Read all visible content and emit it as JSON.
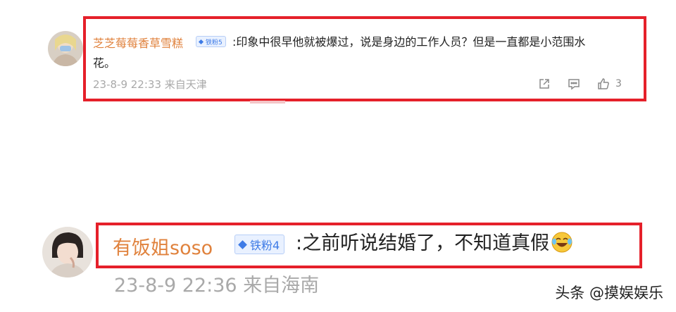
{
  "comments": [
    {
      "username": "芝芝莓莓香草雪糕",
      "badge": "铁粉5",
      "text_line1": ":印象中很早他就被爆过，说是身边的工作人员？但是一直都是小范围水",
      "text_line2": "花。",
      "timestamp": "23-8-9 22:33",
      "location": "来自天津",
      "like_count": "3",
      "icons": [
        "share-icon",
        "comment-icon",
        "like-icon"
      ]
    },
    {
      "username": "有饭姐soso",
      "badge": "铁粉4",
      "text": ":之前听说结婚了，不知道真假",
      "emoji": "laughing-crying-emoji",
      "timestamp": "23-8-9 22:36",
      "location": "来自海南"
    }
  ],
  "watermark": "头条 @摸娱娱乐",
  "colors": {
    "highlight": "#e5202a",
    "username": "#e0823d",
    "badge": "#3e7be6",
    "meta": "#a9a9a9"
  }
}
